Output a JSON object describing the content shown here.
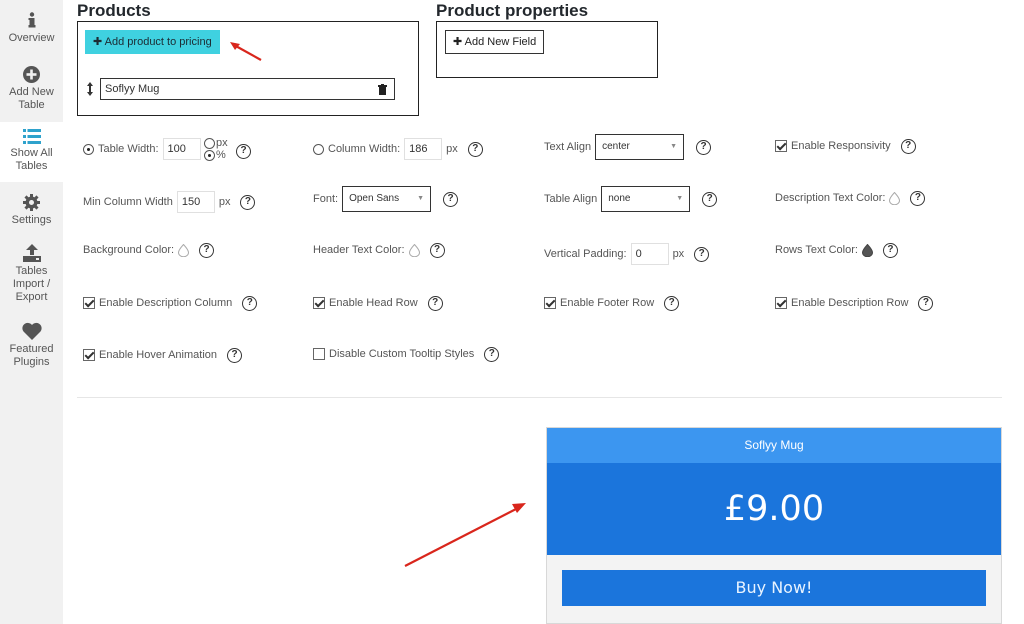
{
  "sidebar": {
    "items": [
      {
        "label": "Overview",
        "icon": "info-icon"
      },
      {
        "label": "Add New Table",
        "icon": "plus-circle-icon"
      },
      {
        "label": "Show All Tables",
        "icon": "list-icon",
        "active": true
      },
      {
        "label": "Settings",
        "icon": "gear-icon"
      },
      {
        "label": "Tables Import / Export",
        "icon": "upload-icon"
      },
      {
        "label": "Featured Plugins",
        "icon": "heart-icon"
      }
    ]
  },
  "products": {
    "title": "Products",
    "add_button": "Add product to pricing",
    "items": [
      {
        "name": "Soflyy Mug"
      }
    ]
  },
  "properties": {
    "title": "Product properties",
    "add_field_button": "Add New Field"
  },
  "settings": {
    "table_width": {
      "label": "Table Width:",
      "value": "100",
      "unit_px": "px",
      "unit_pct": "%"
    },
    "column_width": {
      "label": "Column Width:",
      "value": "186",
      "unit": "px"
    },
    "text_align": {
      "label": "Text Align",
      "value": "center"
    },
    "enable_responsivity": {
      "label": "Enable Responsivity",
      "checked": true
    },
    "min_column_width": {
      "label": "Min Column Width",
      "value": "150",
      "unit": "px"
    },
    "font": {
      "label": "Font:",
      "value": "Open Sans"
    },
    "table_align": {
      "label": "Table Align",
      "value": "none"
    },
    "description_text_color": {
      "label": "Description Text Color:"
    },
    "background_color": {
      "label": "Background Color:"
    },
    "header_text_color": {
      "label": "Header Text Color:"
    },
    "vertical_padding": {
      "label": "Vertical Padding:",
      "value": "0",
      "unit": "px"
    },
    "rows_text_color": {
      "label": "Rows Text Color:",
      "color": "#555555"
    },
    "enable_description_column": {
      "label": "Enable Description Column",
      "checked": true
    },
    "enable_head_row": {
      "label": "Enable Head Row",
      "checked": true
    },
    "enable_footer_row": {
      "label": "Enable Footer Row",
      "checked": true
    },
    "enable_description_row": {
      "label": "Enable Description Row",
      "checked": true
    },
    "enable_hover_animation": {
      "label": "Enable Hover Animation",
      "checked": true
    },
    "disable_custom_tooltip": {
      "label": "Disable Custom Tooltip Styles",
      "checked": false
    }
  },
  "preview": {
    "header": "Soflyy Mug",
    "price": "£9.00",
    "button": "Buy Now!"
  },
  "colors": {
    "accent_cyan": "#3fd1e0",
    "preview_header": "#3c96f0",
    "preview_body": "#1b75dc",
    "annotation_arrow": "#d9261c"
  }
}
